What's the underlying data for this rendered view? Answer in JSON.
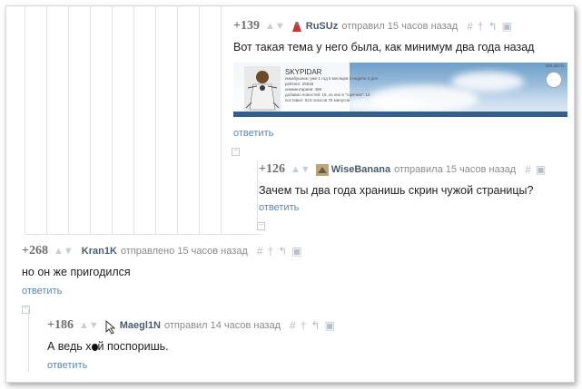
{
  "comments": [
    {
      "rating": "+139",
      "username": "RuSUz",
      "action": "отправил 15 часов назад",
      "text": "Вот такая тема у него была, как минимум два года назад",
      "reply_label": "ответить",
      "has_image": true
    },
    {
      "rating": "+126",
      "username": "WiseBanana",
      "action": "отправила 15 часов назад",
      "text": "Зачем ты два года хранишь скрин чужой страницы?",
      "reply_label": "ответить"
    },
    {
      "rating": "+268",
      "username": "Kran1K",
      "action": "отправлено 15 часов назад",
      "text": "но он же пригодился",
      "reply_label": "ответить"
    },
    {
      "rating": "+186",
      "username": "Maegl1N",
      "action": "отправил 14 часов назад",
      "text_before": "А ведь х",
      "text_after": "й поспоришь.",
      "reply_label": "ответить"
    }
  ],
  "profile_banner": {
    "name": "SKYPIDAR",
    "info_lines": [
      "пикабушник: уже 1 год 5 месяцев 3 недели 3 дня",
      "рейтинг: 25545",
      "комментариев: 486",
      "добавил новостей: 15, из них в \"горячем\": 12",
      "поставил: 523 плюсов  76 минусов"
    ],
    "watermark": "vpa.as.ru"
  },
  "tool_icons": [
    "hash-icon",
    "dagger-icon",
    "arrow-icon",
    "save-icon"
  ],
  "colors": {
    "username": "#4a5a70",
    "reply": "#5b86b8",
    "text": "#222222",
    "thread_lines": "#dfe3e8"
  }
}
